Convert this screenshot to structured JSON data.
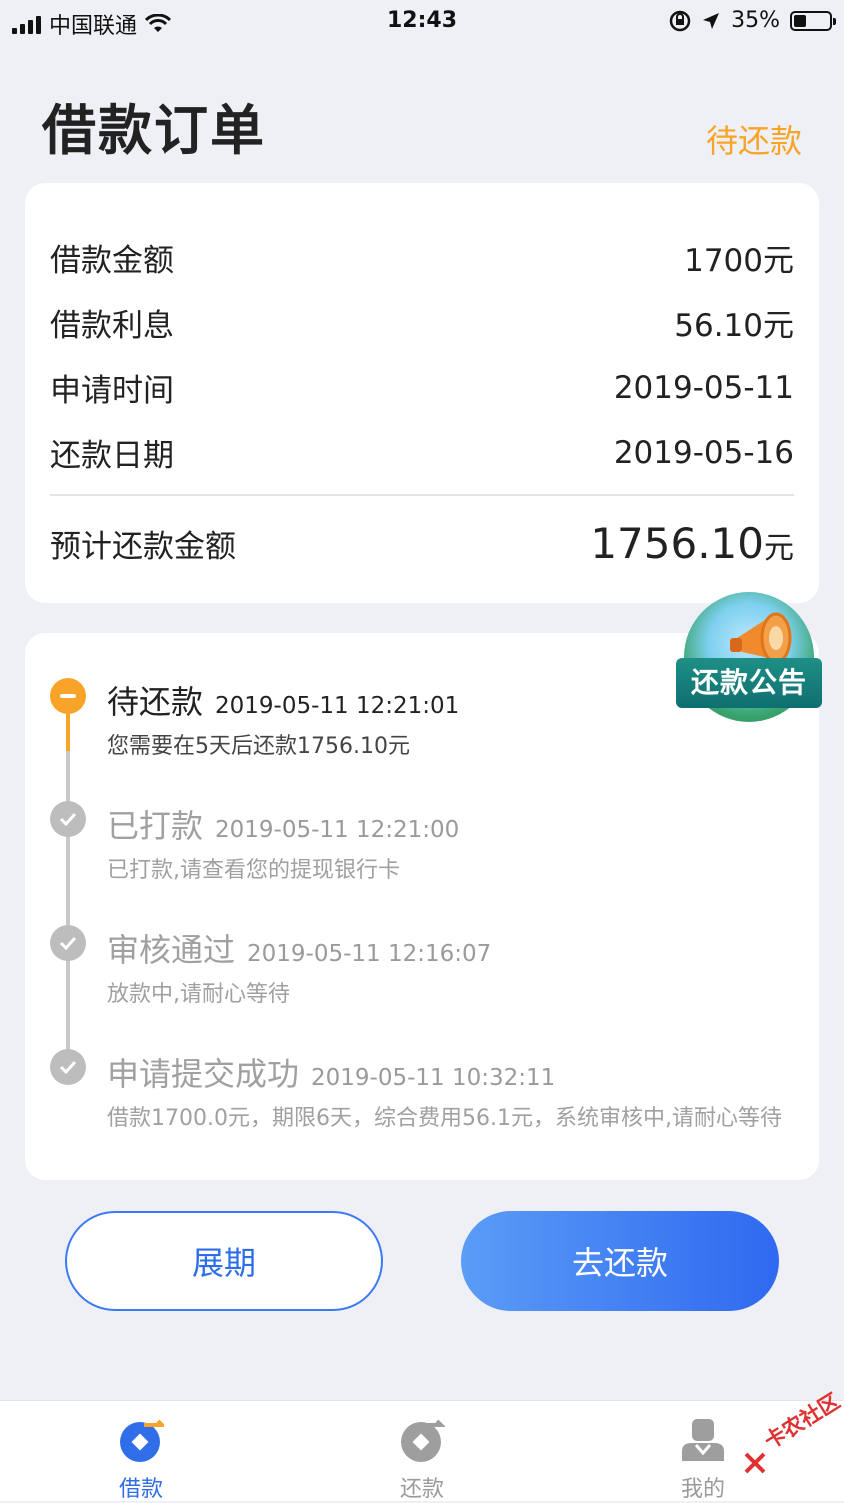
{
  "status_bar": {
    "carrier": "中国联通",
    "time": "12:43",
    "battery_percent": "35%",
    "battery_level": 0.35
  },
  "header": {
    "title": "借款订单",
    "status": "待还款"
  },
  "summary": {
    "rows": [
      {
        "label": "借款金额",
        "value": "1700元"
      },
      {
        "label": "借款利息",
        "value": "56.10元"
      },
      {
        "label": "申请时间",
        "value": "2019-05-11"
      },
      {
        "label": "还款日期",
        "value": "2019-05-16"
      }
    ],
    "total_label": "预计还款金额",
    "total_value": "1756.10",
    "total_unit": "元"
  },
  "notice_badge": {
    "label": "还款公告"
  },
  "timeline": [
    {
      "title": "待还款",
      "time": "2019-05-11 12:21:01",
      "desc": "您需要在5天后还款1756.10元",
      "state": "pending"
    },
    {
      "title": "已打款",
      "time": "2019-05-11 12:21:00",
      "desc": "已打款,请查看您的提现银行卡",
      "state": "done"
    },
    {
      "title": "审核通过",
      "time": "2019-05-11 12:16:07",
      "desc": "放款中,请耐心等待",
      "state": "done"
    },
    {
      "title": "申请提交成功",
      "time": "2019-05-11 10:32:11",
      "desc": "借款1700.0元，期限6天，综合费用56.1元，系统审核中,请耐心等待",
      "state": "done"
    }
  ],
  "actions": {
    "extend": "展期",
    "repay": "去还款"
  },
  "tabs": [
    {
      "label": "借款",
      "icon": "loan-icon",
      "active": true
    },
    {
      "label": "还款",
      "icon": "repay-icon",
      "active": false
    },
    {
      "label": "我的",
      "icon": "profile-icon",
      "active": false
    }
  ],
  "watermark": "卡农社区",
  "colors": {
    "accent_orange": "#f7a428",
    "primary_blue": "#2f6ee8",
    "background": "#eff0f5"
  }
}
